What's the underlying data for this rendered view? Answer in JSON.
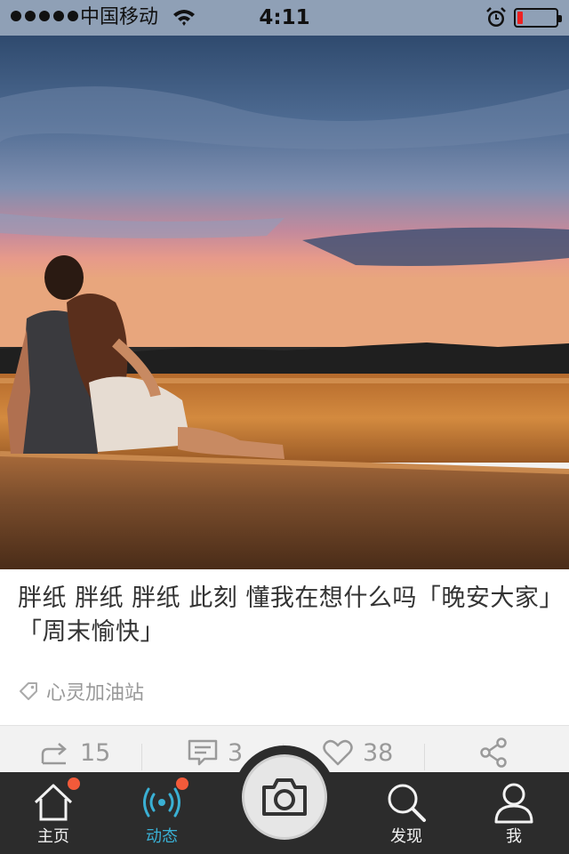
{
  "status_bar": {
    "carrier": "中国移动",
    "time": "4:11",
    "battery_level": 0.15
  },
  "post": {
    "caption": "胖纸 胖纸 胖纸 此刻 懂我在想什么吗「晚安大家」「周末愉快」",
    "tag": "心灵加油站"
  },
  "actions": {
    "repost_count": "15",
    "comment_count": "3",
    "like_count": "38"
  },
  "tabbar": {
    "home_label": "主页",
    "feed_label": "动态",
    "discover_label": "发现",
    "me_label": "我",
    "active_color": "#3ab0d4",
    "badge_color": "#f25a3a"
  }
}
